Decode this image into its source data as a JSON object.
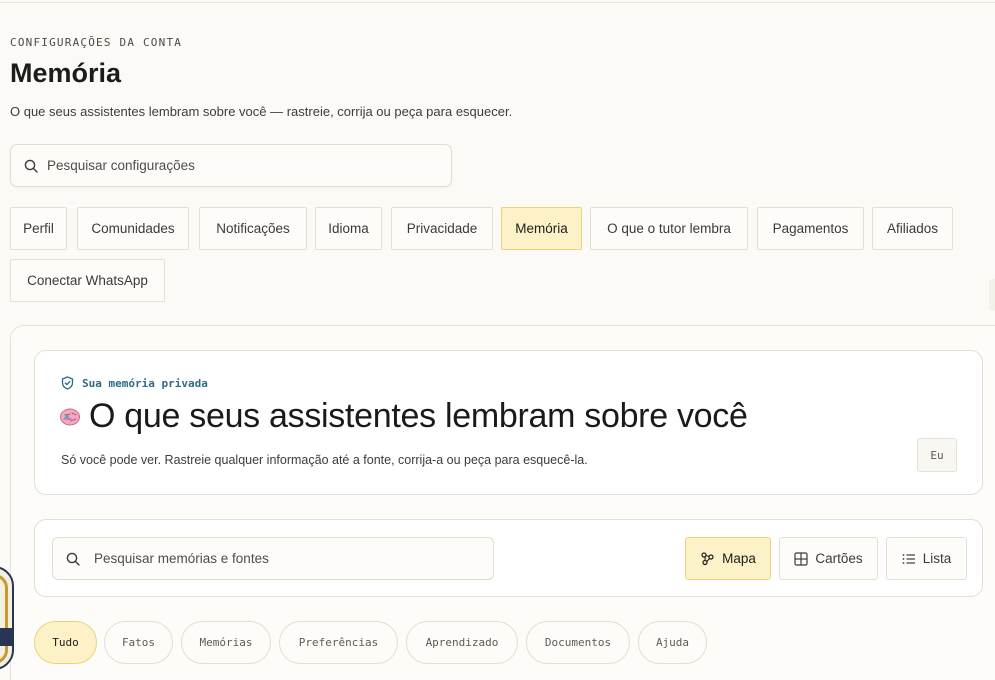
{
  "header": {
    "eyebrow": "CONFIGURAÇÕES DA CONTA",
    "title": "Memória",
    "subtitle": "O que seus assistentes lembram sobre você — rastreie, corrija ou peça para esquecer."
  },
  "settings_search": {
    "placeholder": "Pesquisar configurações",
    "icon": "search-icon"
  },
  "tabs": [
    {
      "label": "Perfil",
      "active": false
    },
    {
      "label": "Comunidades",
      "active": false
    },
    {
      "label": "Notificações",
      "active": false
    },
    {
      "label": "Idioma",
      "active": false
    },
    {
      "label": "Privacidade",
      "active": false
    },
    {
      "label": "Memória",
      "active": true
    },
    {
      "label": "O que o tutor lembra",
      "active": false
    },
    {
      "label": "Pagamentos",
      "active": false
    },
    {
      "label": "Afiliados",
      "active": false
    },
    {
      "label": "Conectar WhatsApp",
      "active": false
    }
  ],
  "hero": {
    "badge": "Sua memória privada",
    "title": "O que seus assistentes lembram sobre você",
    "description": "Só você pode ver. Rastreie qualquer informação até a fonte, corrija-a ou peça para esquecê-la.",
    "me_button": "Eu"
  },
  "memory_search": {
    "placeholder": "Pesquisar memórias e fontes",
    "icon": "search-icon"
  },
  "views": [
    {
      "label": "Mapa",
      "icon": "graph-nodes-icon",
      "active": true
    },
    {
      "label": "Cartões",
      "icon": "grid-icon",
      "active": false
    },
    {
      "label": "Lista",
      "icon": "list-icon",
      "active": false
    }
  ],
  "filters": [
    {
      "label": "Tudo",
      "active": true
    },
    {
      "label": "Fatos",
      "active": false
    },
    {
      "label": "Memórias",
      "active": false
    },
    {
      "label": "Preferências",
      "active": false
    },
    {
      "label": "Aprendizado",
      "active": false
    },
    {
      "label": "Documentos",
      "active": false
    },
    {
      "label": "Ajuda",
      "active": false
    }
  ],
  "colors": {
    "background": "#fbfaf6",
    "accent_fill": "#fcf1c7",
    "accent_border": "#ecd37a",
    "badge_text": "#2b6c86"
  }
}
